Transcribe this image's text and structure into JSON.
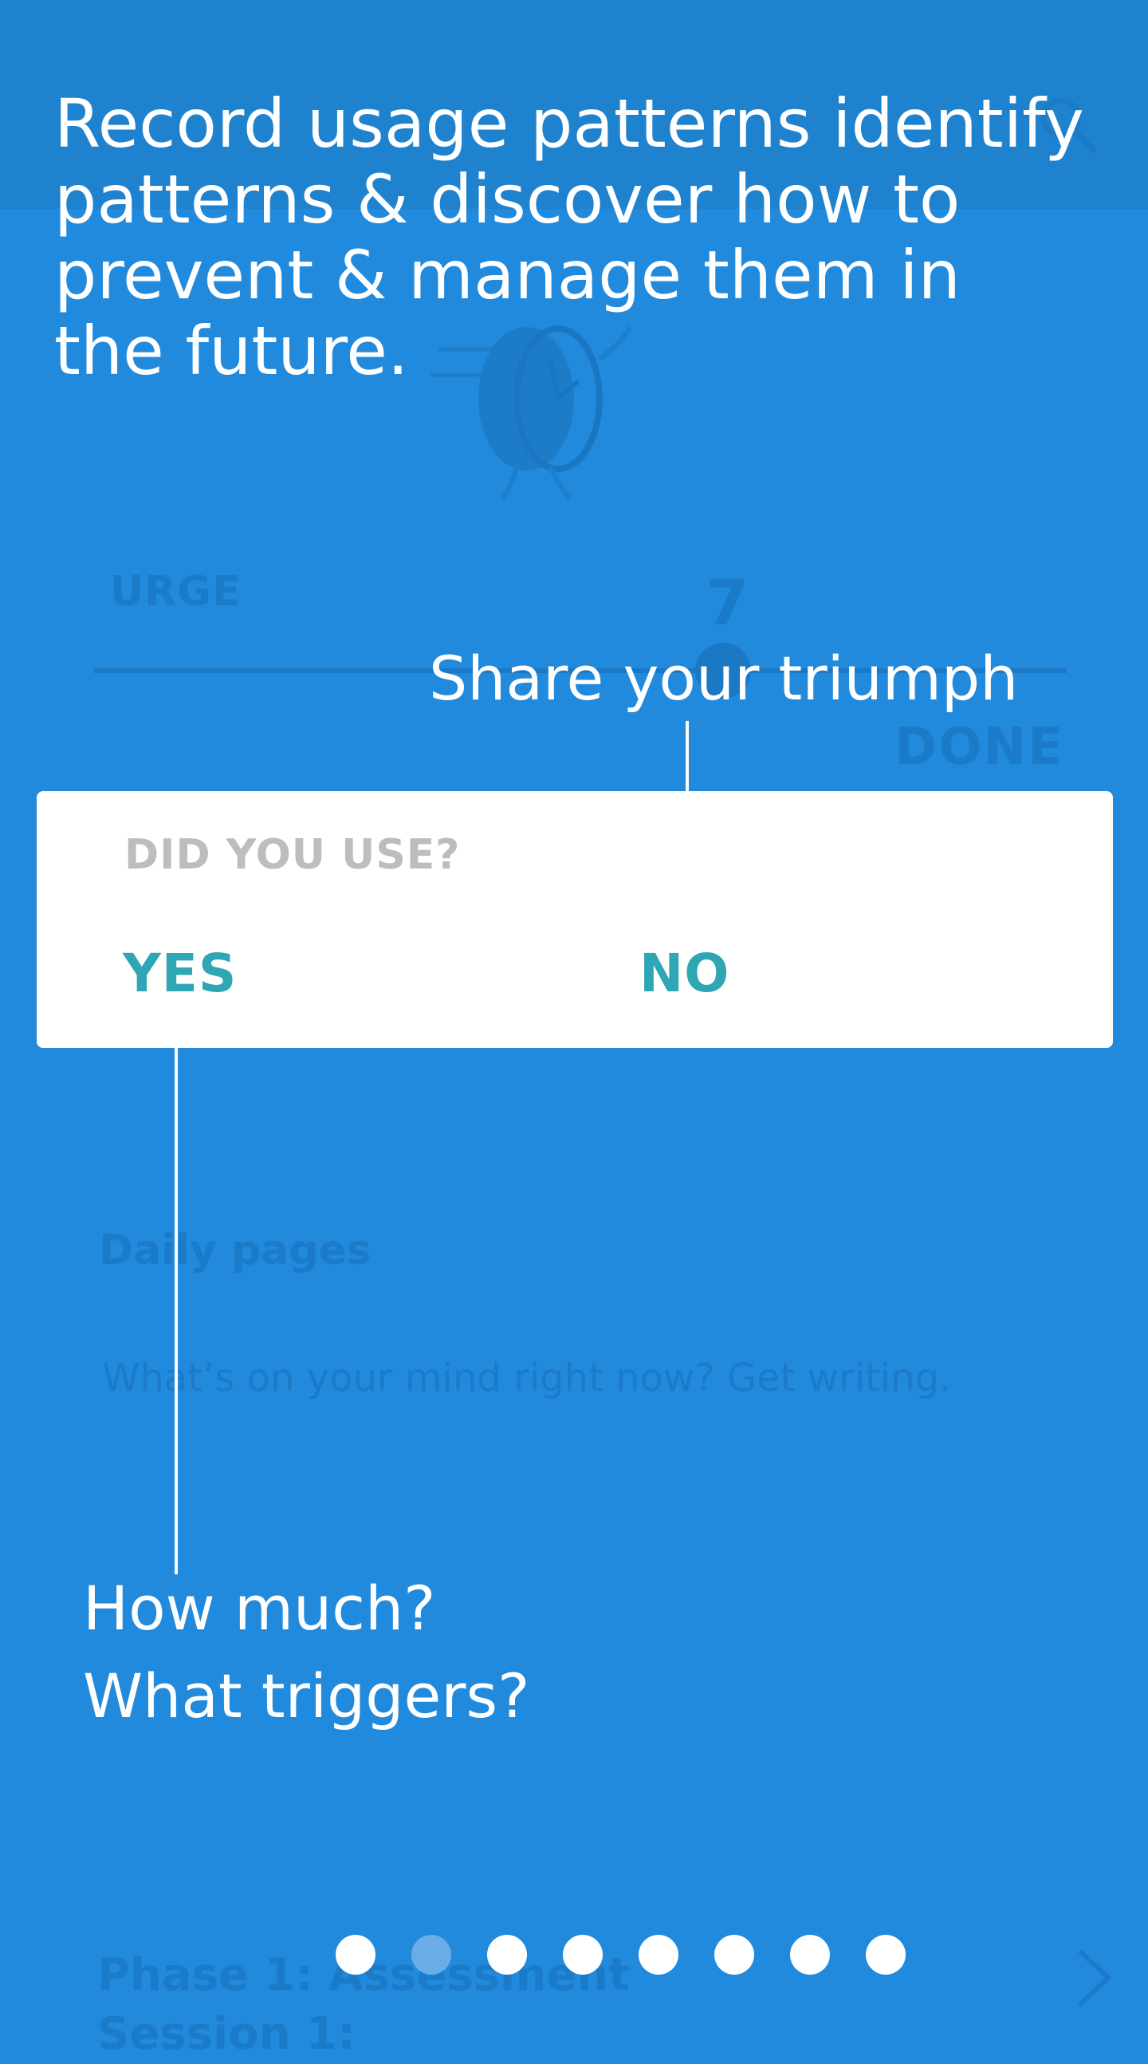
{
  "background": {
    "urge_label": "URGE",
    "urge_value": "7",
    "done_label": "DONE",
    "daily_pages_title": "Daily pages",
    "daily_pages_prompt": "What’s on your mind right now? Get writing.",
    "phase_title": "Phase 1: Assessment",
    "session_title": "Session 1:"
  },
  "overlay": {
    "intro_text": "Record usage patterns identify patterns & discover how to prevent & manage them in the future.",
    "share_text": "Share your triumph",
    "how_much_text": "How much?",
    "triggers_text": "What triggers?"
  },
  "card": {
    "question": "DID YOU USE?",
    "yes_label": "YES",
    "no_label": "NO"
  },
  "pager": {
    "total": 8,
    "active_index": 1
  },
  "colors": {
    "background": "#218ADD",
    "accent": "#2FA6B3",
    "question_text": "#BDBDBD",
    "overlay_text": "#FFFFFF"
  },
  "icons": [
    "search-icon",
    "clock-illustration",
    "chevron-right-icon"
  ]
}
